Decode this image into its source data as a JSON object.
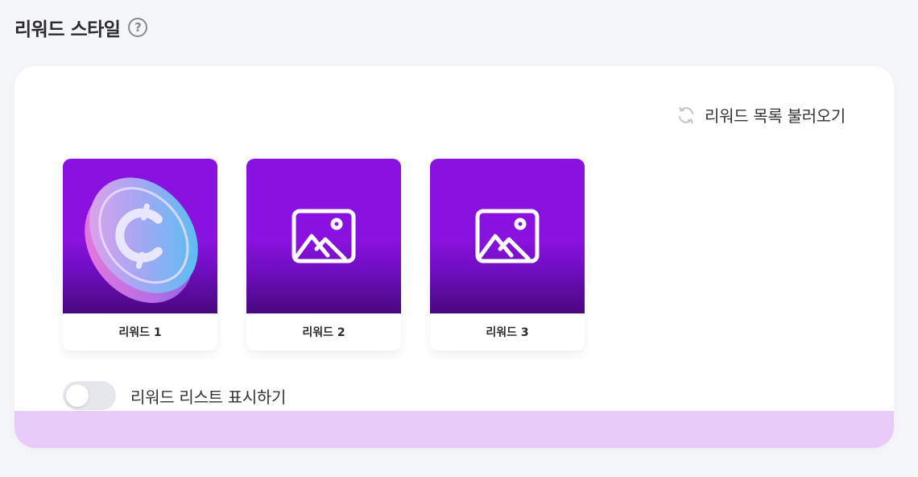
{
  "header": {
    "title": "리워드 스타일",
    "help_icon": "question-circle-icon",
    "help_glyph": "?"
  },
  "panel": {
    "reload_label": "리워드 목록 불러오기",
    "reload_icon": "refresh-icon",
    "rewards": [
      {
        "label": "리워드 1",
        "thumbnail": "coin-image",
        "icon": "coin-icon"
      },
      {
        "label": "리워드 2",
        "thumbnail": "placeholder",
        "icon": "image-placeholder-icon"
      },
      {
        "label": "리워드 3",
        "thumbnail": "placeholder",
        "icon": "image-placeholder-icon"
      }
    ],
    "show_list_toggle": {
      "label": "리워드 리스트 표시하기",
      "checked": false
    }
  },
  "colors": {
    "page_background": "#f5f6fa",
    "card_thumb_purple": "#8a12e0",
    "card_thumb_dark": "#4a087f",
    "footer_strip": "#e8cbf8",
    "toggle_off": "#e6e7ec"
  }
}
